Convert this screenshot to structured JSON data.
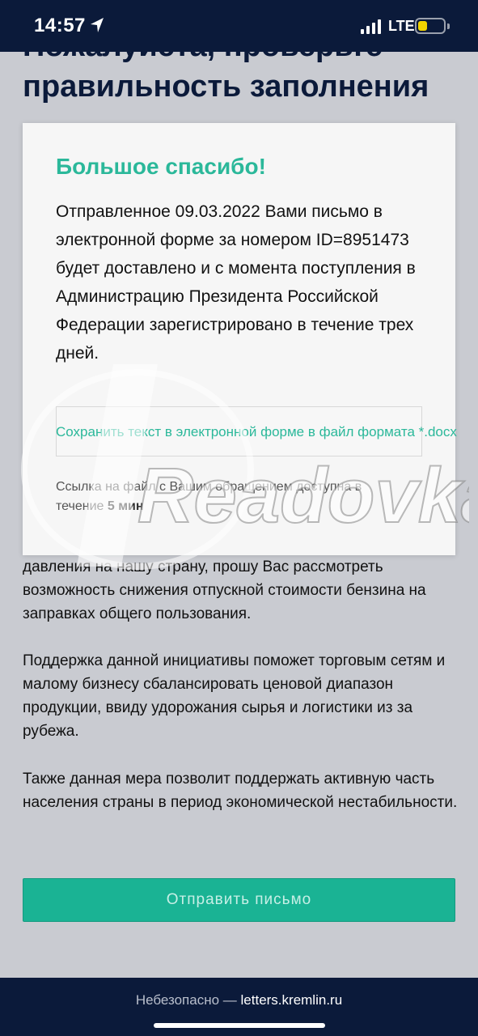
{
  "status": {
    "time": "14:57",
    "network": "LTE",
    "battery_level": 0.35,
    "battery_color": "#f2d400"
  },
  "page": {
    "heading": "Пожалуйста, проверьте правильность заполнения",
    "paragraphs": [
      "давления на нашу страну, прошу Вас рассмотреть возможность снижения отпускной стоимости бензина на заправках общего пользования.",
      "Поддержка данной инициативы поможет торговым сетям и малому бизнесу сбалансировать ценовой диапазон продукции, ввиду удорожания сырья и логистики из за рубежа.",
      "Также данная мера позволит поддержать активную часть населения страны в период экономической нестабильности."
    ],
    "send_button": "Отправить письмо"
  },
  "modal": {
    "title": "Большое спасибо!",
    "message": "Отправленное 09.03.2022 Вами письмо в электронной форме за номером ID=8951473 будет доставлено и с момента поступления в Администрацию Президента Российской Федерации зарегистрировано в течение трех дней.",
    "save_link": "Сохранить текст в электронной форме в файл формата *.docx",
    "link_note_prefix": "Ссылка на файл с Вашим обращением доступна в течение ",
    "link_note_time": "5 мин"
  },
  "watermark": {
    "text": "Readovka"
  },
  "browser": {
    "insecure_label": "Небезопасно —",
    "host": "letters.kremlin.ru"
  },
  "colors": {
    "accent": "#2bb89a",
    "button": "#1ab394",
    "bar": "#0b1a3a"
  }
}
